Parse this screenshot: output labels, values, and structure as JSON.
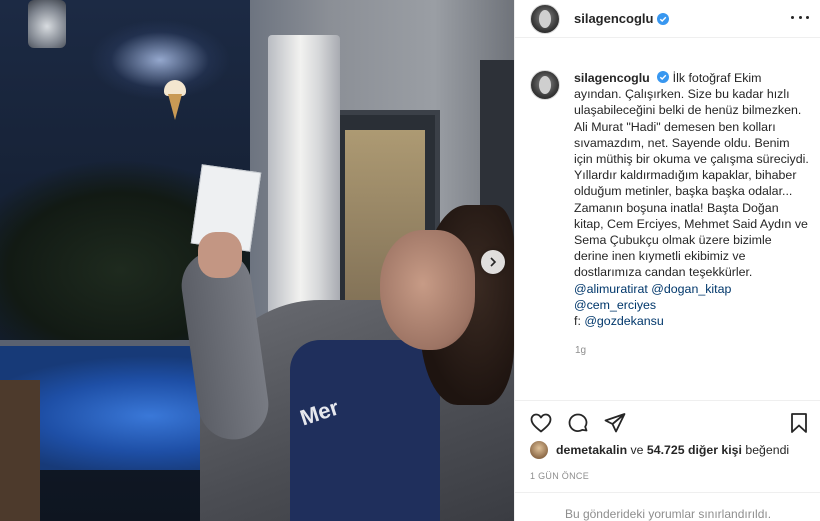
{
  "post": {
    "username": "silagencoglu",
    "photo_overlay_text": "Mer",
    "caption": {
      "username": "silagencoglu",
      "text": "İlk fotoğraf Ekim ayından. Çalışırken. Size bu kadar hızlı ulaşabileceğini belki de henüz bilmezken. Ali Murat \"Hadi\" demesen ben kolları sıvamazdım, net. Sayende oldu. Benim için müthiş bir okuma ve çalışma süreciydi. Yıllardır kaldırmadığım kapaklar, bihaber olduğum metinler, başka başka odalar... Zamanın boşuna inatla! Başta Doğan kitap, Cem Erciyes, Mehmet Said Aydın ve Sema Çubukçu olmak üzere bizimle derine inen kıymetli ekibimiz ve dostlarımıza candan teşekkürler.",
      "mentions_line1": "@alimuratirat @dogan_kitap",
      "mentions_line2": "@cem_erciyes",
      "photo_credit_prefix": "f: ",
      "photo_credit": "@gozdekansu"
    },
    "caption_age": "1g",
    "likes": {
      "first_liker": "demetakalin",
      "connector": " ve ",
      "count_text": "54.725 diğer kişi",
      "suffix": " beğendi"
    },
    "posted_ago": "1 GÜN ÖNCE",
    "comments_limited": "Bu gönderideki yorumlar sınırlandırıldı."
  },
  "icons": {
    "like": "heart-icon",
    "comment": "comment-icon",
    "share": "paper-plane-icon",
    "save": "bookmark-icon",
    "more": "more-options-icon",
    "next": "chevron-right-icon",
    "verified": "verified-badge-icon"
  },
  "colors": {
    "verified": "#3897f0",
    "mention": "#00376b",
    "muted": "#8e8e8e",
    "text": "#262626"
  }
}
